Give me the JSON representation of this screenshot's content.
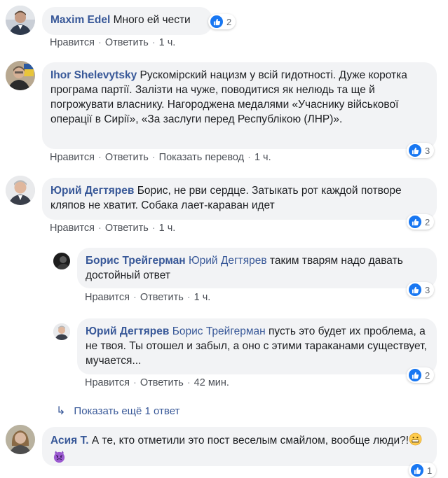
{
  "actions": {
    "like": "Нравится",
    "reply": "Ответить",
    "translate": "Показать перевод",
    "sep": "·"
  },
  "comments": [
    {
      "author": "Maxim Edel",
      "text": "Много ей чести",
      "time": "1 ч.",
      "likes": "2"
    },
    {
      "author": "Ihor Shelevytsky",
      "text": "Рускомірский нацизм у всій гидотності. Дуже коротка програма партії. Залізти на чуже, поводитися як нелюдь та ще й погрожувати власнику. Нагороджена медалями «Учаснику військової операції в Сирії», «За заслуги перед Республікою (ЛНР)».",
      "time": "1 ч.",
      "likes": "3"
    },
    {
      "author": "Юрий Дегтярев",
      "text": "Борис, не рви сердце. Затыкать рот каждой потворе кляпов не хватит. Собака лает-караван идет",
      "time": "1 ч.",
      "likes": "2"
    },
    {
      "author": "Асия Т.",
      "text": "А те, кто отметили это пост веселым смайлом, вообще люди?!",
      "likes": "1"
    }
  ],
  "replies": [
    {
      "author": "Борис Трейгерман",
      "mention": "Юрий Дегтярев",
      "text": "таким тварям надо давать достойный ответ",
      "time": "1 ч.",
      "likes": "3"
    },
    {
      "author": "Юрий Дегтярев",
      "mention": "Борис Трейгерман",
      "text": "пусть это будет их проблема, а не твоя. Ты отошел и забыл, а оно с этими тараканами существует, мучается...",
      "time": "42 мин.",
      "likes": "2"
    }
  ],
  "show_more": "Показать ещё 1 ответ",
  "icons": {
    "like": "thumbs-up-icon",
    "reply_arrow": "reply-arrow-icon",
    "emoji1": "grimacing-face-icon",
    "emoji2": "angry-devil-icon"
  },
  "colors": {
    "link": "#385898",
    "like_blue": "#1877f2",
    "bubble": "#f2f3f5"
  }
}
